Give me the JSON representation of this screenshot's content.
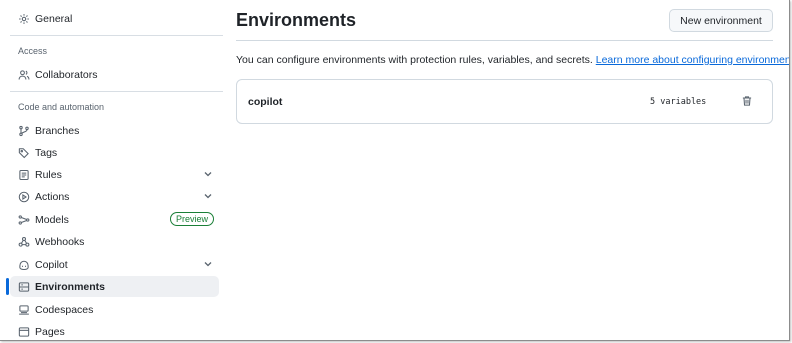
{
  "sidebar": {
    "general": "General",
    "access_heading": "Access",
    "collaborators": "Collaborators",
    "code_heading": "Code and automation",
    "branches": "Branches",
    "tags": "Tags",
    "rules": "Rules",
    "actions": "Actions",
    "models": "Models",
    "models_badge": "Preview",
    "webhooks": "Webhooks",
    "copilot": "Copilot",
    "environments": "Environments",
    "codespaces": "Codespaces",
    "pages": "Pages",
    "active_item": "Environments"
  },
  "main": {
    "title": "Environments",
    "new_button": "New environment",
    "description": "You can configure environments with protection rules, variables, and secrets.",
    "learn_more": "Learn more about configuring environments.",
    "environments": [
      {
        "name": "copilot",
        "variables": "5 variables"
      }
    ]
  },
  "colors": {
    "accent": "#0969da",
    "badge_green": "#1a7f37",
    "active_bg": "#eef0f3"
  }
}
